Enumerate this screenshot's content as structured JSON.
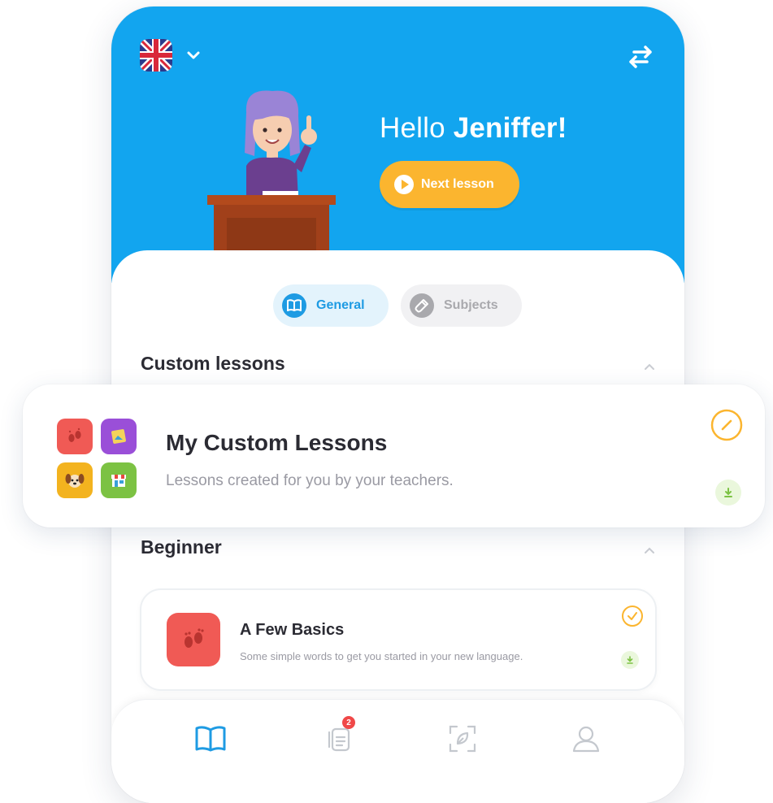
{
  "header": {
    "language_flag_icon": "uk-flag-icon",
    "greeting_prefix": "Hello",
    "user_name": "Jeniffer!",
    "next_lesson_label": "Next lesson"
  },
  "tabs": [
    {
      "label": "General",
      "icon": "book-icon",
      "active": true
    },
    {
      "label": "Subjects",
      "icon": "flask-icon",
      "active": false
    }
  ],
  "sections": {
    "custom": {
      "title": "Custom lessons"
    },
    "beginner": {
      "title": "Beginner"
    }
  },
  "featured_card": {
    "title": "My Custom Lessons",
    "description": "Lessons created for you by your teachers."
  },
  "lesson_card": {
    "title": "A Few Basics",
    "description": "Some simple words to get you started in your new language."
  },
  "bottom_nav": [
    {
      "name": "lessons",
      "icon": "book-icon",
      "active": true
    },
    {
      "name": "notes",
      "icon": "notes-icon",
      "badge": "2"
    },
    {
      "name": "scan",
      "icon": "scan-icon"
    },
    {
      "name": "profile",
      "icon": "profile-icon"
    }
  ],
  "colors": {
    "primary_blue": "#12a5ef",
    "accent_yellow": "#fbb52f",
    "tile_red": "#f05a55",
    "download_green_bg": "#eaf7dc",
    "badge_red": "#f04848"
  }
}
